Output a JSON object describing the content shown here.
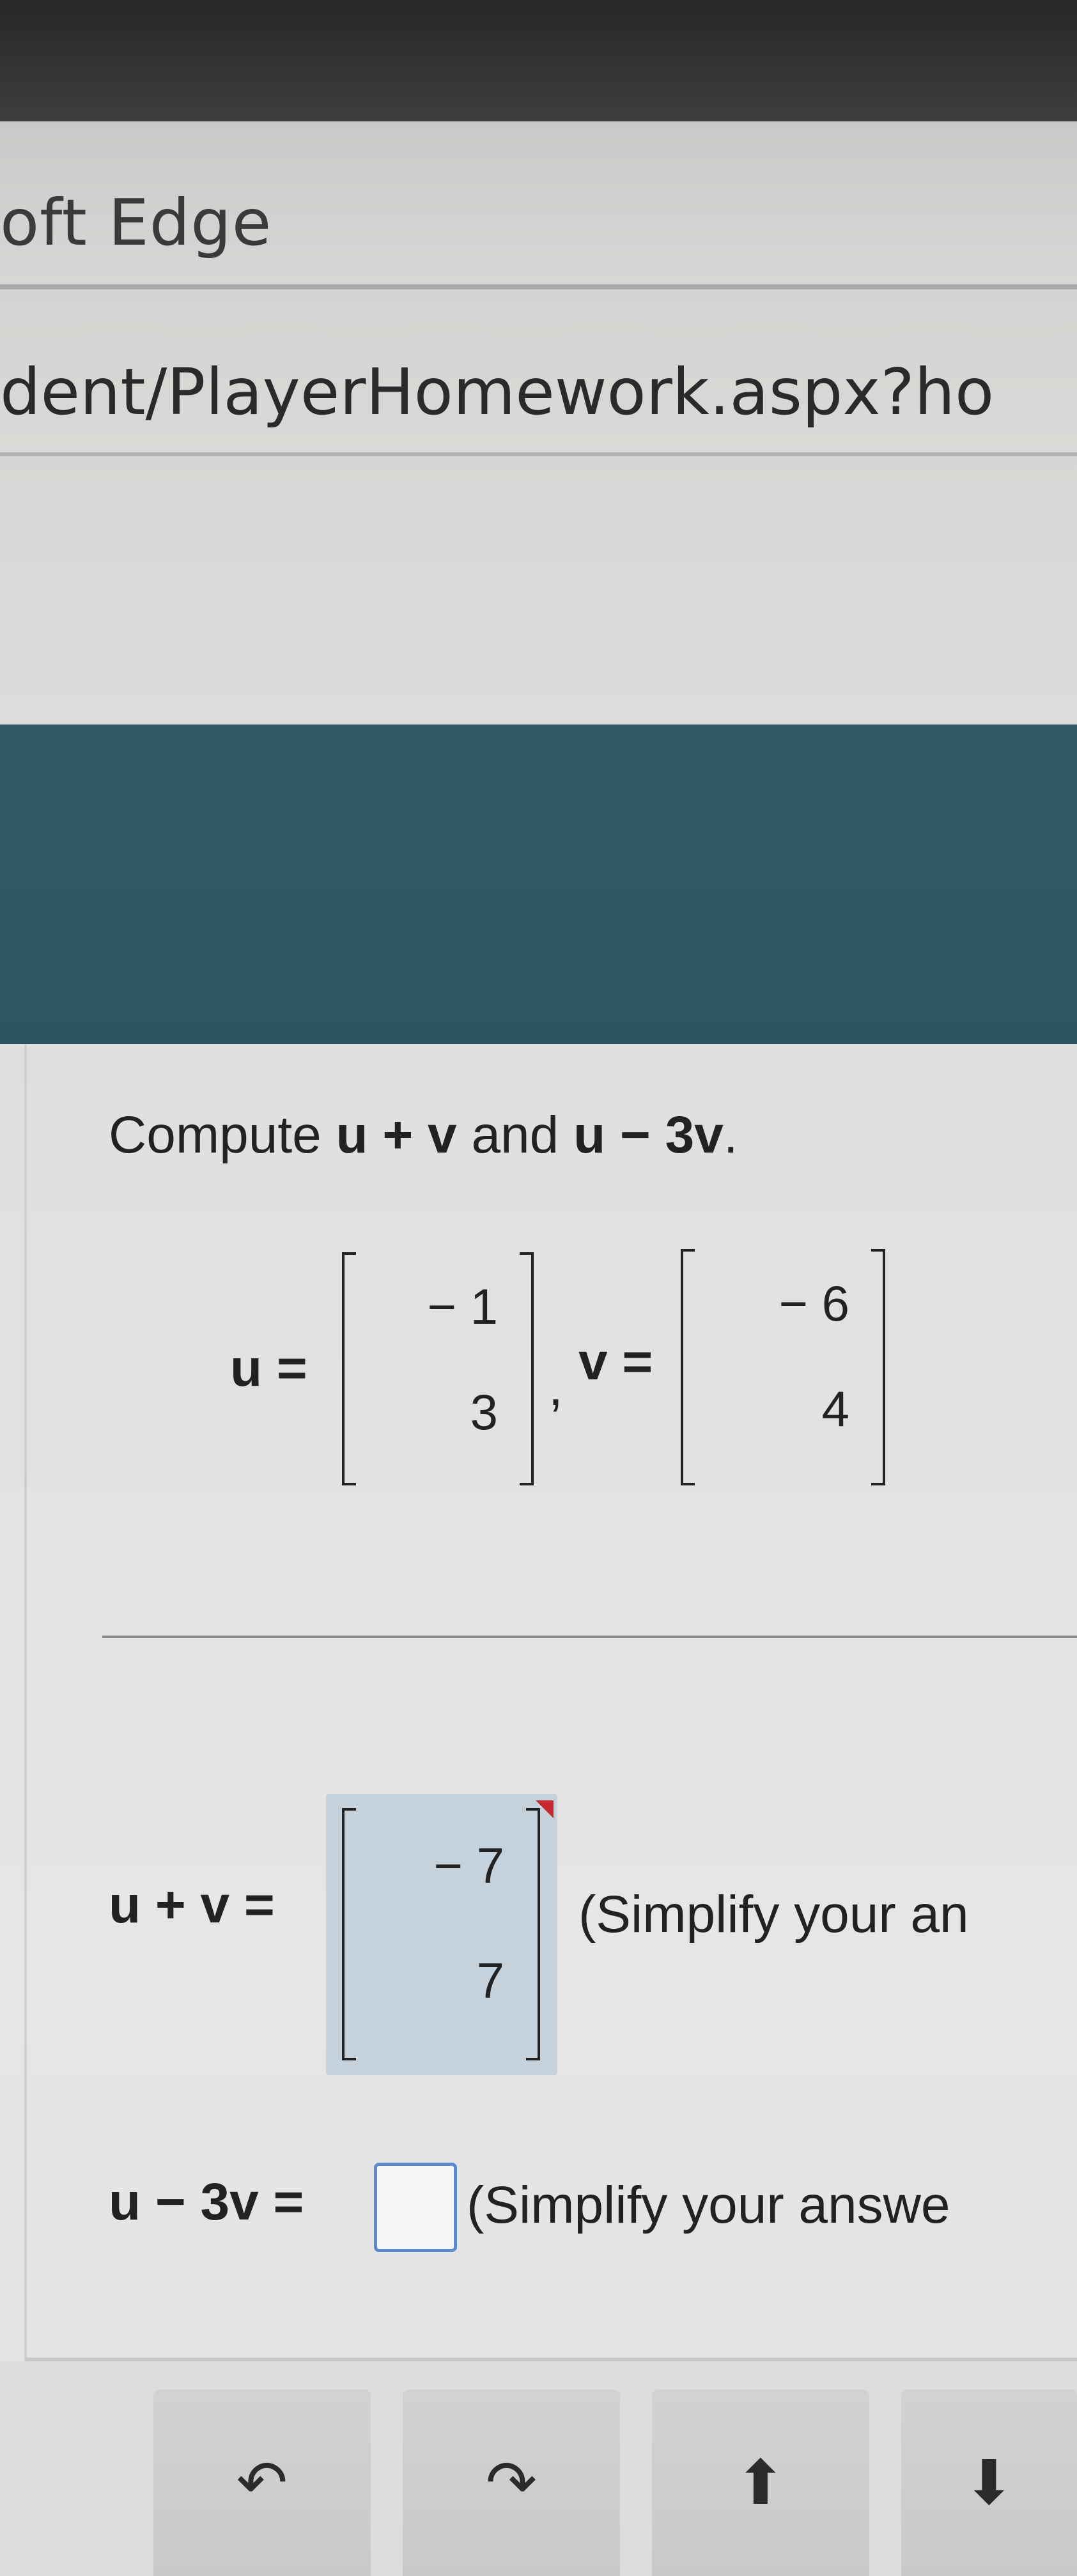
{
  "browser": {
    "title_fragment": "oft Edge",
    "address_fragment": "dent/PlayerHomework.aspx?ho"
  },
  "question": {
    "prefix": "Compute ",
    "expr1": "u + v",
    "middle": " and ",
    "expr2": "u − 3v",
    "suffix": "."
  },
  "vectors": {
    "u_label": "u =",
    "u_values": [
      "− 1",
      "3"
    ],
    "separator": ",",
    "v_label": "v =",
    "v_values": [
      "− 6",
      "4"
    ]
  },
  "answers": {
    "sum_label": "u + v =",
    "sum_values": [
      "− 7",
      "7"
    ],
    "sum_note": "(Simplify your an",
    "diff_label": "u − 3v =",
    "diff_value": "",
    "diff_note": "(Simplify your answe"
  },
  "toolbar": {
    "icons": [
      "undo-icon",
      "redo-icon",
      "arrow-up-icon",
      "arrow-down-icon"
    ],
    "undo_glyph": "↶",
    "redo_glyph": "↷",
    "up_glyph": "⬆",
    "down_glyph": "⬇"
  }
}
